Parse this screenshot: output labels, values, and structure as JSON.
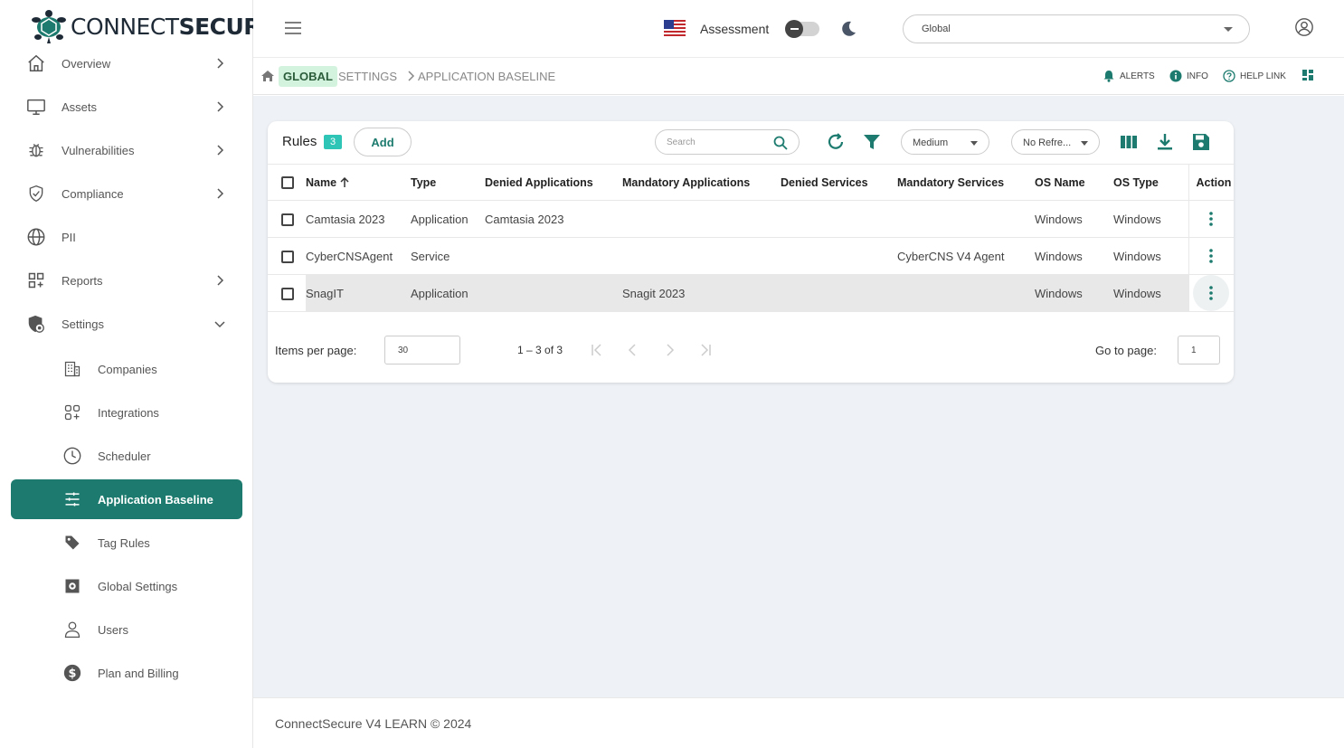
{
  "brand": {
    "name_thin": "CONNECT",
    "name_bold": "SECURE",
    "color": "#1c7b6e"
  },
  "sidebar": {
    "items": [
      {
        "label": "Overview",
        "icon": "home-icon"
      },
      {
        "label": "Assets",
        "icon": "monitor-icon"
      },
      {
        "label": "Vulnerabilities",
        "icon": "bug-icon"
      },
      {
        "label": "Compliance",
        "icon": "shield-check-icon"
      },
      {
        "label": "PII",
        "icon": "globe-icon"
      },
      {
        "label": "Reports",
        "icon": "reports-grid-icon"
      },
      {
        "label": "Settings",
        "icon": "settings-shield-icon"
      }
    ],
    "settings_children": [
      {
        "label": "Companies",
        "icon": "building-icon"
      },
      {
        "label": "Integrations",
        "icon": "integrations-icon"
      },
      {
        "label": "Scheduler",
        "icon": "clock-icon"
      },
      {
        "label": "Application Baseline",
        "icon": "sliders-icon",
        "active": true
      },
      {
        "label": "Tag Rules",
        "icon": "tag-icon"
      },
      {
        "label": "Global Settings",
        "icon": "global-settings-icon"
      },
      {
        "label": "Users",
        "icon": "user-icon"
      },
      {
        "label": "Plan and Billing",
        "icon": "dollar-icon"
      }
    ]
  },
  "topbar": {
    "assessment_label": "Assessment",
    "assessment_toggle": false,
    "company_select": "Global"
  },
  "breadcrumb": {
    "global": "GLOBAL",
    "settings": "SETTINGS",
    "current": "APPLICATION BASELINE",
    "links": {
      "alerts": "ALERTS",
      "info": "INFO",
      "help": "HELP LINK"
    }
  },
  "rules": {
    "title": "Rules",
    "count": "3",
    "add_label": "Add",
    "search_placeholder": "Search",
    "severity_select": "Medium",
    "refresh_select": "No Refre..."
  },
  "table": {
    "columns": [
      "Name",
      "Type",
      "Denied Applications",
      "Mandatory Applications",
      "Denied Services",
      "Mandatory Services",
      "OS Name",
      "OS Type",
      "Action"
    ],
    "rows": [
      {
        "name": "Camtasia 2023",
        "type": "Application",
        "denied_apps": "Camtasia 2023",
        "mandatory_apps": "",
        "denied_services": "",
        "mandatory_services": "",
        "os_name": "Windows",
        "os_type": "Windows"
      },
      {
        "name": "CyberCNSAgent",
        "type": "Service",
        "denied_apps": "",
        "mandatory_apps": "",
        "denied_services": "",
        "mandatory_services": "CyberCNS V4 Agent",
        "os_name": "Windows",
        "os_type": "Windows"
      },
      {
        "name": "SnagIT",
        "type": "Application",
        "denied_apps": "",
        "mandatory_apps": "Snagit 2023",
        "denied_services": "",
        "mandatory_services": "",
        "os_name": "Windows",
        "os_type": "Windows"
      }
    ]
  },
  "pager": {
    "items_per_page_label": "Items per page:",
    "items_per_page": "30",
    "range": "1 – 3 of 3",
    "goto_label": "Go to page:",
    "goto_value": "1"
  },
  "footer": {
    "text": "ConnectSecure V4 LEARN © 2024"
  }
}
